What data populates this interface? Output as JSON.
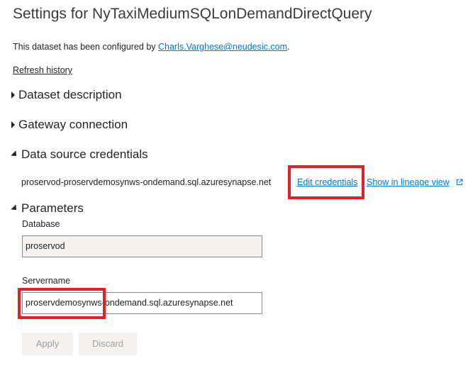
{
  "header": {
    "title": "Settings for NyTaxiMediumSQLonDemandDirectQuery"
  },
  "configured": {
    "prefix": "This dataset has been configured by ",
    "email": "Charls.Varghese@neudesic.com",
    "suffix": "."
  },
  "refresh_history": "Refresh history",
  "sections": {
    "dataset_description": "Dataset description",
    "gateway_connection": "Gateway connection",
    "data_source_credentials": "Data source credentials",
    "parameters": "Parameters"
  },
  "credentials": {
    "source": "proservod-proservdemosynws-ondemand.sql.azuresynapse.net",
    "edit_label": "Edit credentials",
    "lineage_label": "Show in lineage view"
  },
  "parameters": {
    "database_label": "Database",
    "database_value": "proservod",
    "servername_label": "Servername",
    "servername_value": "proservdemosynws-ondemand.sql.azuresynapse.net"
  },
  "buttons": {
    "apply": "Apply",
    "discard": "Discard"
  },
  "colors": {
    "link": "#0078d4",
    "highlight": "#e3202a"
  },
  "icons": {
    "external": "external-link-icon"
  }
}
